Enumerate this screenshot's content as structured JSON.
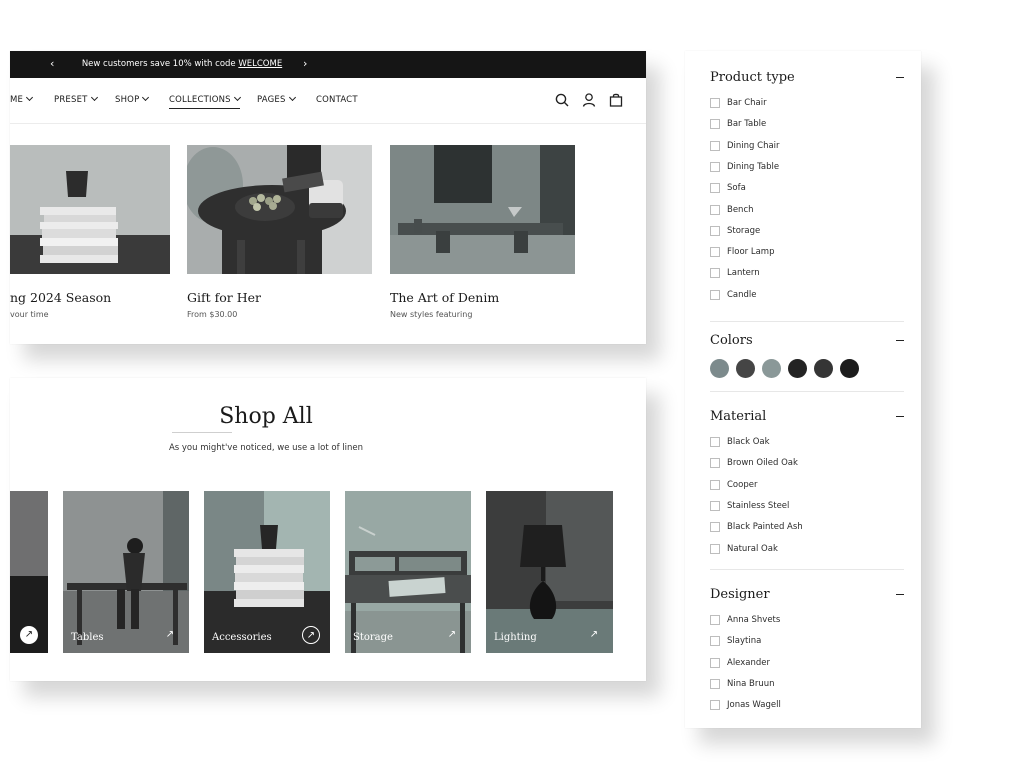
{
  "announcement": {
    "text": "New customers save 10% with code ",
    "code": "WELCOME",
    "prev_icon": "‹",
    "next_icon": "›"
  },
  "nav": {
    "items": [
      "ME",
      "PRESET",
      "SHOP",
      "COLLECTIONS",
      "PAGES",
      "CONTACT"
    ],
    "active": "COLLECTIONS",
    "icons": [
      "search-icon",
      "account-icon",
      "cart-icon"
    ]
  },
  "featured": [
    {
      "title": "ng 2024 Season",
      "subtitle": "vour time"
    },
    {
      "title": "Gift for Her",
      "subtitle": "From $30.00"
    },
    {
      "title": "The Art of Denim",
      "subtitle": "New styles featuring"
    }
  ],
  "shop_all": {
    "title": "Shop All",
    "subtitle": "As you might've noticed, we use a lot of linen",
    "tiles": [
      {
        "label": ""
      },
      {
        "label": "Tables"
      },
      {
        "label": "Accessories"
      },
      {
        "label": "Storage"
      },
      {
        "label": "Lighting"
      }
    ],
    "arrow_icon": "↗"
  },
  "filters": {
    "product_type": {
      "title": "Product type",
      "options": [
        "Bar Chair",
        "Bar Table",
        "Dining Chair",
        "Dining Table",
        "Sofa",
        "Bench",
        "Storage",
        "Floor Lamp",
        "Lantern",
        "Candle"
      ]
    },
    "colors": {
      "title": "Colors",
      "swatches": [
        "#7c8a8c",
        "#454545",
        "#8a9898",
        "#232323",
        "#353535",
        "#1c1c1c"
      ]
    },
    "material": {
      "title": "Material",
      "options": [
        "Black Oak",
        "Brown Oiled Oak",
        "Cooper",
        "Stainless Steel",
        "Black Painted Ash",
        "Natural Oak"
      ]
    },
    "designer": {
      "title": "Designer",
      "options": [
        "Anna Shvets",
        "Slaytina",
        "Alexander",
        "Nina Bruun",
        "Jonas Wagell"
      ]
    }
  }
}
